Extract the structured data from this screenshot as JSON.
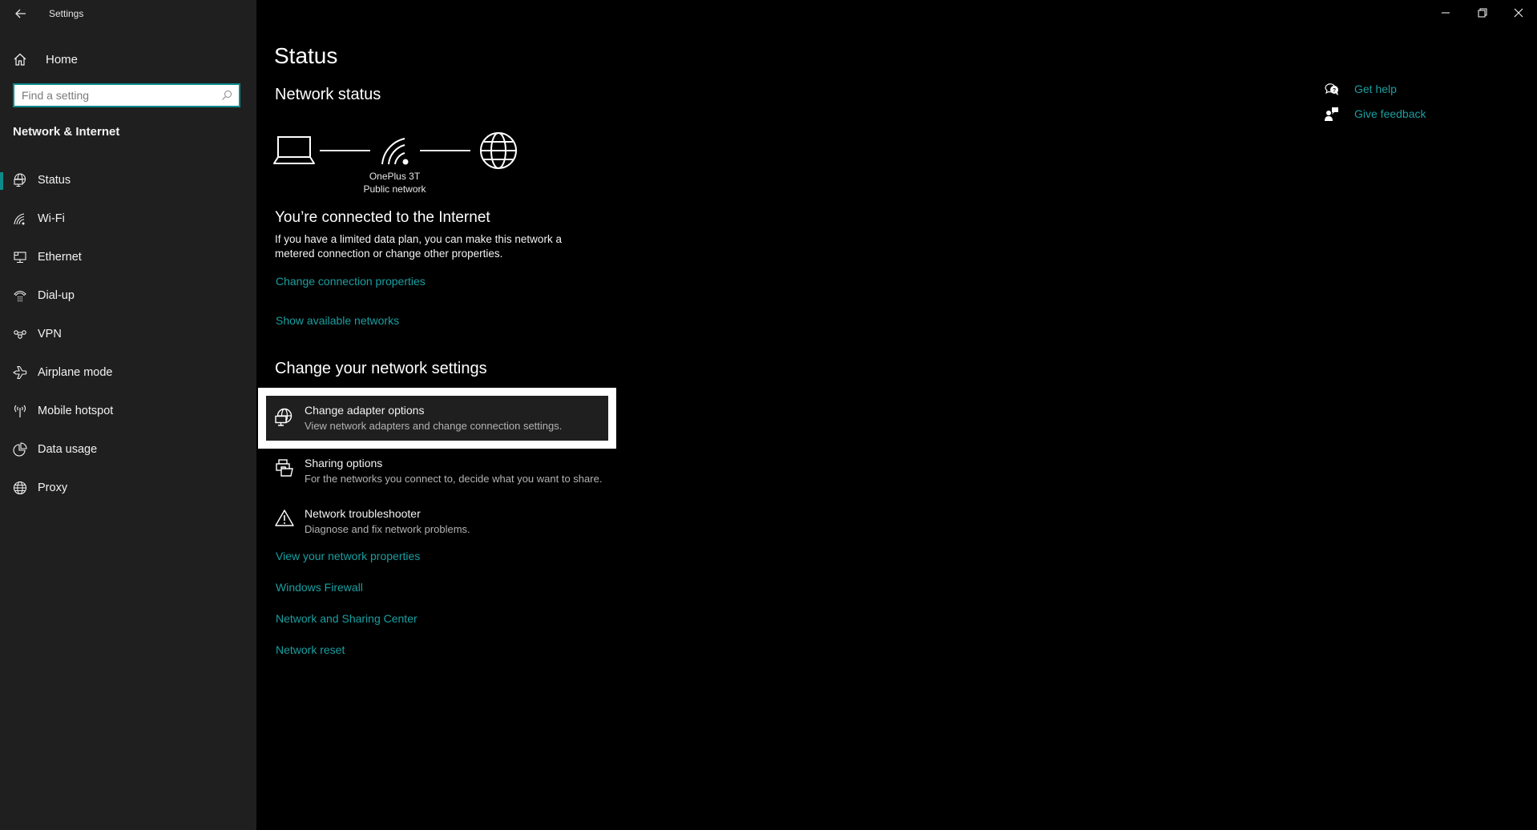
{
  "window": {
    "title": "Settings",
    "controls": {
      "minimize": "minimize-icon",
      "restore": "restore-icon",
      "close": "close-icon"
    }
  },
  "sidebar": {
    "home_label": "Home",
    "search_placeholder": "Find a setting",
    "search_value": "",
    "section_label": "Network & Internet",
    "active_item": "Status",
    "items": [
      {
        "label": "Status",
        "icon": "network-status-icon",
        "active": true
      },
      {
        "label": "Wi-Fi",
        "icon": "wifi-icon"
      },
      {
        "label": "Ethernet",
        "icon": "ethernet-icon"
      },
      {
        "label": "Dial-up",
        "icon": "dialup-phone-icon"
      },
      {
        "label": "VPN",
        "icon": "vpn-icon"
      },
      {
        "label": "Airplane mode",
        "icon": "airplane-icon"
      },
      {
        "label": "Mobile hotspot",
        "icon": "hotspot-icon"
      },
      {
        "label": "Data usage",
        "icon": "pie-chart-icon"
      },
      {
        "label": "Proxy",
        "icon": "globe-icon"
      }
    ]
  },
  "main": {
    "title": "Status",
    "network_status_heading": "Network status",
    "diagram": {
      "network_name": "OnePlus 3T",
      "network_type": "Public network"
    },
    "connected_heading": "You’re connected to the Internet",
    "connected_desc_line1": "If you have a limited data plan, you can make this network a",
    "connected_desc_line2": "metered connection or change other properties.",
    "links_top": [
      "Change connection properties",
      "Show available networks"
    ],
    "change_heading": "Change your network settings",
    "options": [
      {
        "title": "Change adapter options",
        "subtitle": "View network adapters and change connection settings.",
        "icon": "adapter-icon",
        "selected": true
      },
      {
        "title": "Sharing options",
        "subtitle": "For the networks you connect to, decide what you want to share.",
        "icon": "sharing-icon"
      },
      {
        "title": "Network troubleshooter",
        "subtitle": "Diagnose and fix network problems.",
        "icon": "warning-icon"
      }
    ],
    "links_bottom": [
      "View your network properties",
      "Windows Firewall",
      "Network and Sharing Center",
      "Network reset"
    ]
  },
  "help": {
    "get_help": "Get help",
    "give_feedback": "Give feedback"
  },
  "colors": {
    "accent": "#1a9fa1",
    "sidebar_bg": "#1f1f1f",
    "main_bg": "#000000"
  }
}
